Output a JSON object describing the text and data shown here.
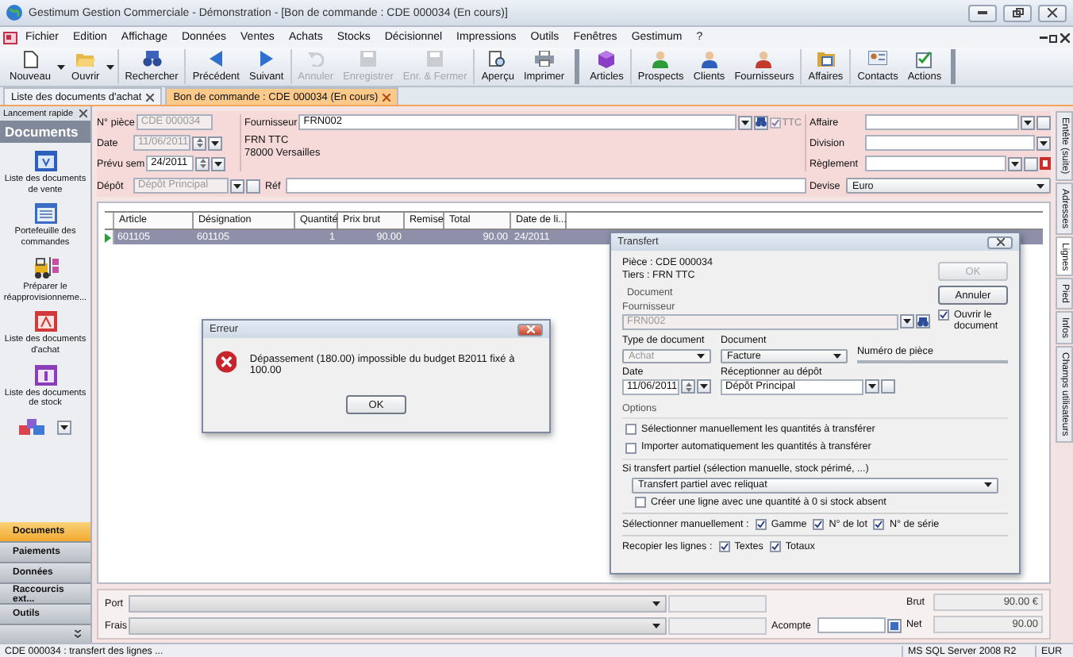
{
  "window": {
    "title": "Gestimum Gestion Commerciale - Démonstration - [Bon de commande : CDE 000034 (En cours)]"
  },
  "menu": [
    "Fichier",
    "Edition",
    "Affichage",
    "Données",
    "Ventes",
    "Achats",
    "Stocks",
    "Décisionnel",
    "Impressions",
    "Outils",
    "Fenêtres",
    "Gestimum",
    "?"
  ],
  "toolbars": [
    {
      "groups": [
        [
          {
            "label": "Nouveau",
            "kind": "new",
            "disabled": false,
            "dropdown": true
          },
          {
            "label": "Ouvrir",
            "kind": "open",
            "disabled": false,
            "dropdown": true
          }
        ],
        [
          {
            "label": "Rechercher",
            "kind": "search",
            "disabled": false,
            "dropdown": false
          }
        ],
        [
          {
            "label": "Précédent",
            "kind": "prev",
            "disabled": false,
            "dropdown": false
          },
          {
            "label": "Suivant",
            "kind": "next",
            "disabled": false,
            "dropdown": false
          }
        ],
        [
          {
            "label": "Annuler",
            "kind": "undo",
            "disabled": true,
            "dropdown": false
          },
          {
            "label": "Enregistrer",
            "kind": "save",
            "disabled": true,
            "dropdown": false
          },
          {
            "label": "Enr. & Fermer",
            "kind": "save",
            "disabled": true,
            "dropdown": false
          }
        ],
        [
          {
            "label": "Aperçu",
            "kind": "preview",
            "disabled": false,
            "dropdown": false
          },
          {
            "label": "Imprimer",
            "kind": "print",
            "disabled": false,
            "dropdown": false
          }
        ]
      ]
    },
    {
      "groups": [
        [
          {
            "label": "Articles",
            "kind": "cube",
            "disabled": false,
            "dropdown": false
          }
        ],
        [
          {
            "label": "Prospects",
            "kind": "prospect",
            "disabled": false,
            "dropdown": false
          },
          {
            "label": "Clients",
            "kind": "client",
            "disabled": false,
            "dropdown": false
          },
          {
            "label": "Fournisseurs",
            "kind": "supplier",
            "disabled": false,
            "dropdown": false
          }
        ],
        [
          {
            "label": "Affaires",
            "kind": "folder",
            "disabled": false,
            "dropdown": false
          }
        ],
        [
          {
            "label": "Contacts",
            "kind": "contacts",
            "disabled": false,
            "dropdown": false
          },
          {
            "label": "Actions",
            "kind": "actions",
            "disabled": false,
            "dropdown": false
          }
        ]
      ]
    }
  ],
  "doc_tabs": [
    {
      "label": "Liste des documents d'achat",
      "selected": false
    },
    {
      "label": "Bon de commande : CDE 000034 (En cours)",
      "selected": true
    }
  ],
  "sidebar": {
    "title": "Lancement rapide",
    "heading": "Documents",
    "items": [
      {
        "label": "Liste des documents\nde vente",
        "kind": "window"
      },
      {
        "label": "Portefeuille des\ncommandes",
        "kind": "list"
      },
      {
        "label": "Préparer le\nréapprovisionneme...",
        "kind": "forklift"
      },
      {
        "label": "Liste des documents\nd'achat",
        "kind": "purchase"
      },
      {
        "label": "Liste des documents\nde stock",
        "kind": "stock"
      }
    ],
    "sections": [
      {
        "label": "Documents",
        "selected": true
      },
      {
        "label": "Paiements",
        "selected": false
      },
      {
        "label": "Données",
        "selected": false
      },
      {
        "label": "Raccourcis ext...",
        "selected": false
      },
      {
        "label": "Outils",
        "selected": false
      }
    ]
  },
  "header": {
    "numero": {
      "label": "N° pièce",
      "value": "CDE 000034",
      "disabled": true
    },
    "date": {
      "label": "Date",
      "value": "11/06/2011",
      "disabled": true
    },
    "prevu": {
      "label": "Prévu sem",
      "value": "24/2011",
      "disabled": false
    },
    "fournisseur": {
      "label": "Fournisseur",
      "value": "FRN002",
      "address": "FRN TTC\n78000 Versailles"
    },
    "ttc": {
      "label": "TTC",
      "checked": true
    },
    "right": [
      {
        "label": "Affaire"
      },
      {
        "label": "Division"
      },
      {
        "label": "Règlement"
      }
    ],
    "depot": {
      "label": "Dépôt",
      "value": "Dépôt Principal",
      "disabled": true
    },
    "ref": {
      "label": "Réf"
    },
    "devise": {
      "label": "Devise",
      "value": "Euro"
    }
  },
  "table": {
    "columns": [
      "Article",
      "Désignation",
      "Quantité",
      "Prix brut",
      "Remise",
      "Total",
      "Date de li..."
    ],
    "rows": [
      {
        "selected": true,
        "cells": [
          "601105",
          "601105",
          "1",
          "90.00",
          null,
          "90.00",
          "24/2011"
        ]
      }
    ]
  },
  "totals": {
    "port": "Port",
    "frais": "Frais",
    "acompte": "Acompte",
    "brut": {
      "label": "Brut",
      "value": "90.00 €"
    },
    "net": {
      "label": "Net",
      "value": "90.00"
    }
  },
  "right_tabs": [
    {
      "label": "Entête (suite)",
      "selected": false
    },
    {
      "label": "Adresses",
      "selected": false
    },
    {
      "label": "Lignes",
      "selected": true
    },
    {
      "label": "Pied",
      "selected": false
    },
    {
      "label": "Infos",
      "selected": false
    },
    {
      "label": "Champs utilisateurs",
      "selected": false
    }
  ],
  "status": {
    "message": "CDE 000034 : transfert des lignes ...",
    "server": "MS SQL Server 2008 R2",
    "currency": "EUR"
  },
  "error_dialog": {
    "title": "Erreur",
    "message": "Dépassement (180.00) impossible du budget B2011 fixé à 100.00",
    "button": "OK"
  },
  "transfer_dialog": {
    "title": "Transfert",
    "piece": "Pièce : CDE 000034",
    "tiers": "Tiers : FRN TTC",
    "ok": {
      "label": "OK",
      "disabled": true
    },
    "cancel": {
      "label": "Annuler"
    },
    "open_doc": {
      "label": "Ouvrir le\ndocument",
      "checked": true
    },
    "document_group": "Document",
    "fournisseur": {
      "label": "Fournisseur",
      "value": "FRN002"
    },
    "type": {
      "label": "Type de document",
      "value": "Achat"
    },
    "document": {
      "label": "Document",
      "value": "Facture"
    },
    "numero": {
      "label": "Numéro de pièce"
    },
    "date": {
      "label": "Date",
      "value": "11/06/2011"
    },
    "depot": {
      "label": "Réceptionner au dépôt",
      "value": "Dépôt Principal"
    },
    "options": {
      "label": "Options",
      "items": [
        {
          "label": "Sélectionner manuellement les quantités à transférer",
          "checked": false
        },
        {
          "label": "Importer automatiquement les quantités à transférer",
          "checked": false
        }
      ]
    },
    "partial": {
      "label": "Si transfert partiel (sélection manuelle, stock périmé, ...)",
      "value": "Transfert partiel avec reliquat",
      "create_line": {
        "label": "Créer une ligne avec une quantité à 0 si stock absent",
        "checked": false
      }
    },
    "select_manual": {
      "label": "Sélectionner manuellement :",
      "items": [
        {
          "label": "Gamme",
          "checked": true
        },
        {
          "label": "N° de lot",
          "checked": true
        },
        {
          "label": "N° de série",
          "checked": true
        }
      ]
    },
    "copy_lines": {
      "label": "Recopier les lignes :",
      "items": [
        {
          "label": "Textes",
          "checked": true
        },
        {
          "label": "Totaux",
          "checked": true
        }
      ]
    }
  }
}
